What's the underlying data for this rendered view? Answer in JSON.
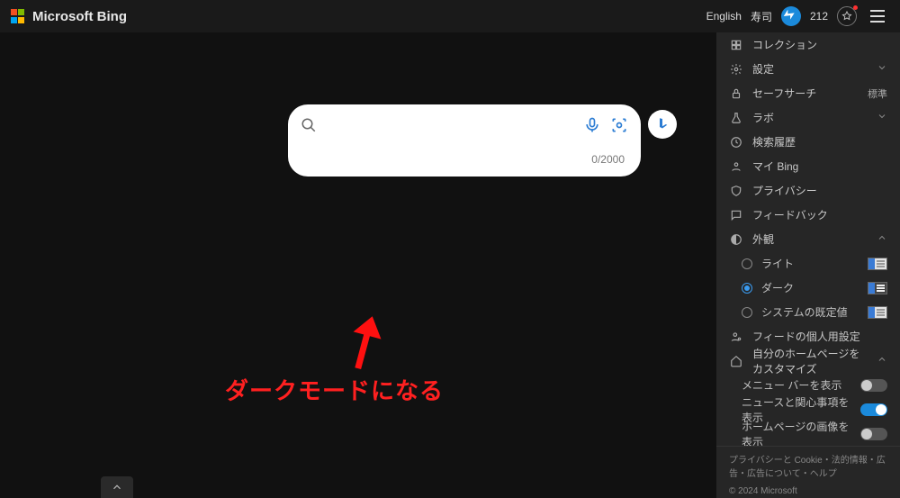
{
  "header": {
    "brand": "Microsoft Bing",
    "language": "English",
    "username": "寿司",
    "points": "212"
  },
  "search": {
    "placeholder": "",
    "value": "",
    "counter": "0/2000"
  },
  "annotation": {
    "text": "ダークモードになる"
  },
  "panel": {
    "collections": "コレクション",
    "settings": "設定",
    "safesearch": {
      "label": "セーフサーチ",
      "value": "標準"
    },
    "labs": "ラボ",
    "history": "検索履歴",
    "mybing": "マイ Bing",
    "privacy": "プライバシー",
    "feedback": "フィードバック",
    "appearance": {
      "label": "外観",
      "options": {
        "light": "ライト",
        "dark": "ダーク",
        "system": "システムの既定値"
      },
      "selected": "dark"
    },
    "feed_personal": "フィードの個人用設定",
    "customize_home": "自分のホームページをカスタマイズ",
    "toggles": {
      "menubar": {
        "label": "メニュー バーを表示",
        "on": false
      },
      "news": {
        "label": "ニュースと関心事項を表示",
        "on": true
      },
      "image": {
        "label": "ホームページの画像を表示",
        "on": false
      }
    }
  },
  "footer": {
    "links": "プライバシーと Cookie・法的情報・広告・広告について・ヘルプ",
    "copyright": "© 2024 Microsoft"
  }
}
